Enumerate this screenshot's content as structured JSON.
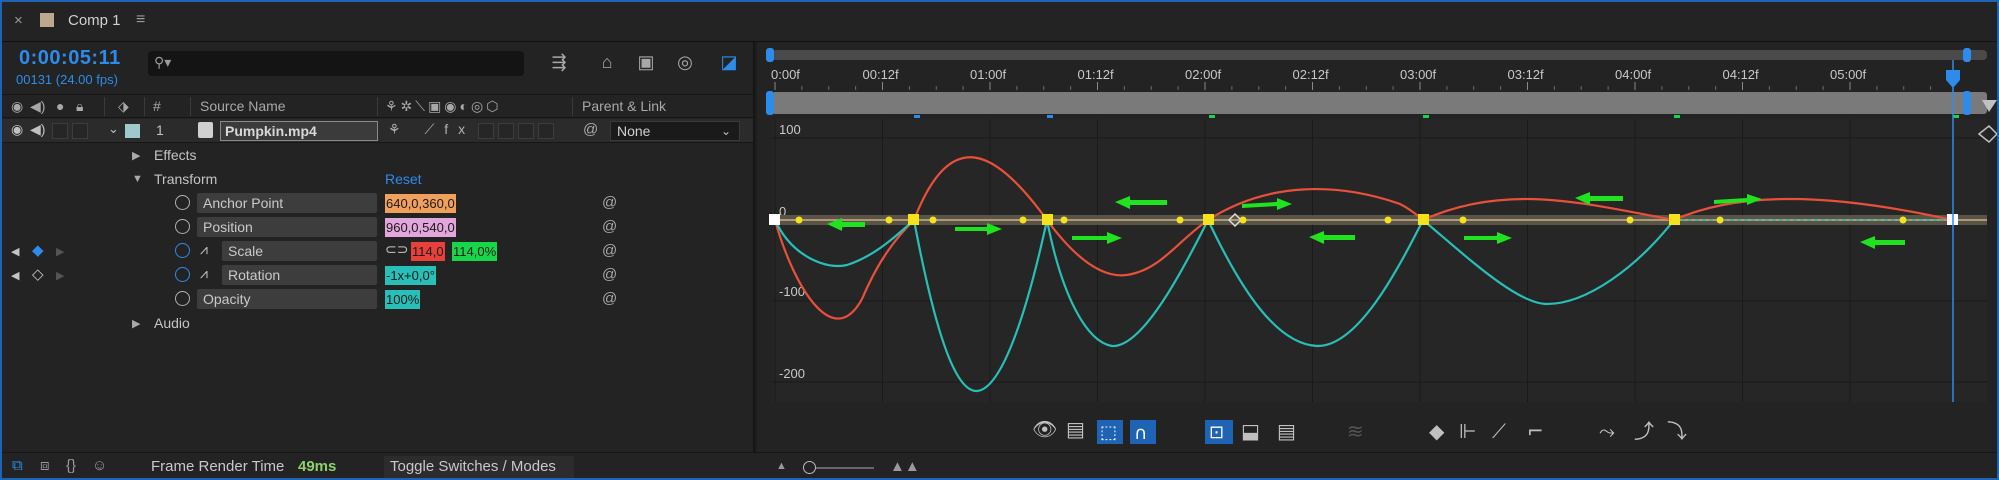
{
  "tab": {
    "close_icon": "close-icon",
    "title": "Comp 1",
    "menu_icon": "hamburger-menu-icon",
    "swatch_color": "#bca88f"
  },
  "timeline": {
    "timecode": "0:00:05:11",
    "frame_info": "00131 (24.00 fps)",
    "search_placeholder": "",
    "columns": {
      "number": "#",
      "source_name": "Source Name",
      "parent": "Parent & Link"
    }
  },
  "layer": {
    "number": "1",
    "name": "Pumpkin.mp4",
    "label_color": "#9fcacc",
    "parent_value": "None"
  },
  "groups": {
    "effects": "Effects",
    "transform": "Transform",
    "reset": "Reset",
    "audio": "Audio"
  },
  "properties": [
    {
      "label": "Anchor Point",
      "values": [
        "640,0,360,0"
      ],
      "colors": [
        "#f0a05a"
      ]
    },
    {
      "label": "Position",
      "values": [
        "960,0,540,0"
      ],
      "colors": [
        "#e3a6dc"
      ]
    },
    {
      "label": "Scale",
      "values": [
        "114,0",
        "114,0%"
      ],
      "colors": [
        "#e8403a",
        "#17d64a"
      ]
    },
    {
      "label": "Rotation",
      "values": [
        "-1x+0,0°"
      ],
      "colors": [
        "#27bfb8"
      ]
    },
    {
      "label": "Opacity",
      "values": [
        "100%"
      ],
      "colors": [
        "#27bfb8"
      ]
    }
  ],
  "ruler": {
    "ticks": [
      "0:00f",
      "00:12f",
      "01:00f",
      "01:12f",
      "02:00f",
      "02:12f",
      "03:00f",
      "03:12f",
      "04:00f",
      "04:12f",
      "05:00f"
    ]
  },
  "graph": {
    "y_labels": [
      "100",
      "0",
      "-100",
      "-200"
    ],
    "curve_colors": {
      "x_scale": "#e8503a",
      "y_scale": "#27bfb8",
      "rotation": "#b6a074"
    }
  },
  "graph_toolbar_icons": [
    "eye-icon",
    "graph-type-icon",
    "transform-box-icon",
    "snap-icon",
    "fit-selection-icon",
    "fit-all-icon",
    "edit-speed-icon",
    "separate-dimensions-icon",
    "keyframe-icon",
    "hold-icon",
    "linear-icon",
    "auto-bezier-icon",
    "easy-ease-icon",
    "ease-in-icon",
    "ease-out-icon"
  ],
  "bottom": {
    "render_label": "Frame Render Time",
    "render_value": "49ms",
    "toggle_label": "Toggle Switches / Modes"
  }
}
